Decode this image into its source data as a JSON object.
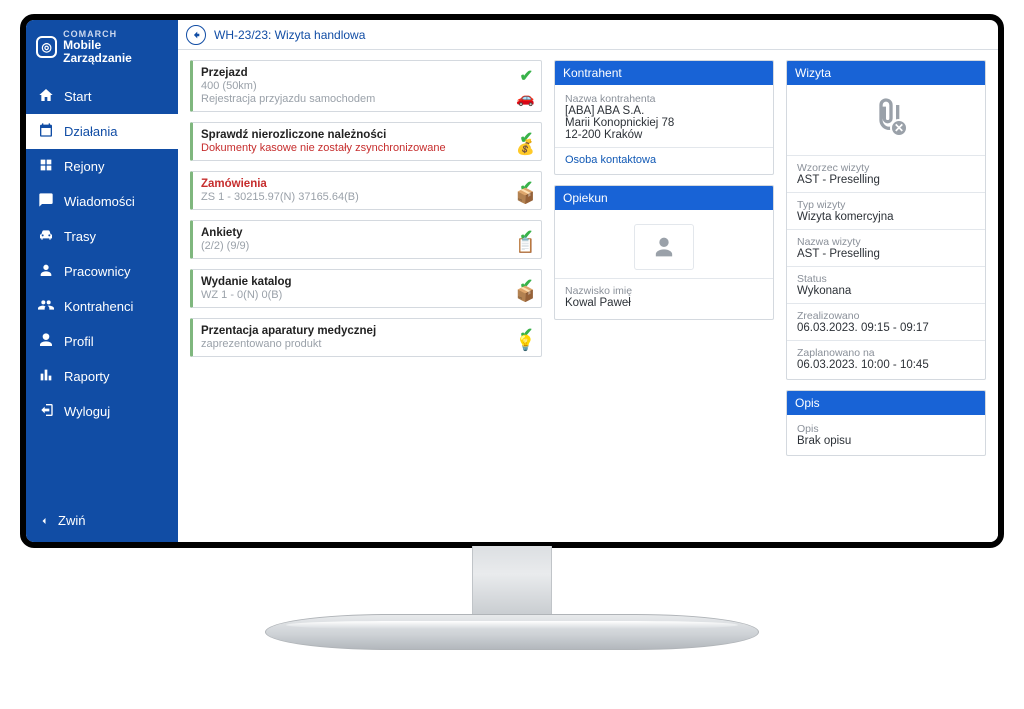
{
  "brand": {
    "top": "COMARCH",
    "bottom": "Mobile Zarządzanie"
  },
  "sidebar": {
    "items": [
      {
        "label": "Start",
        "icon": "home-icon"
      },
      {
        "label": "Działania",
        "icon": "calendar-icon",
        "active": true
      },
      {
        "label": "Rejony",
        "icon": "regions-icon"
      },
      {
        "label": "Wiadomości",
        "icon": "chat-icon"
      },
      {
        "label": "Trasy",
        "icon": "car-icon"
      },
      {
        "label": "Pracownicy",
        "icon": "users-icon"
      },
      {
        "label": "Kontrahenci",
        "icon": "contacts-icon"
      },
      {
        "label": "Profil",
        "icon": "profile-icon"
      },
      {
        "label": "Raporty",
        "icon": "chart-icon"
      },
      {
        "label": "Wyloguj",
        "icon": "logout-icon"
      }
    ],
    "collapse": "Zwiń"
  },
  "topbar": {
    "title": "WH-23/23: Wizyta handlowa"
  },
  "tasks": [
    {
      "title": "Przejazd",
      "line1": "400 (50km)",
      "line2": "Rejestracja przyjazdu samochodem",
      "icon": "🚗"
    },
    {
      "title": "Sprawdź nierozliczone należności",
      "line2": "Dokumenty kasowe nie zostały zsynchronizowane",
      "line2_red": true,
      "icon": "💰"
    },
    {
      "title": "Zamówienia",
      "title_red": true,
      "line1": "ZS 1 - 30215.97(N) 37165.64(B)",
      "icon": "📦"
    },
    {
      "title": "Ankiety",
      "line1": "(2/2) (9/9)",
      "icon": "📋"
    },
    {
      "title": "Wydanie katalog",
      "line1": "WZ 1 - 0(N) 0(B)",
      "icon": "📦"
    },
    {
      "title": "Przentacja aparatury medycznej",
      "line1": "zaprezentowano produkt",
      "icon": "💡"
    }
  ],
  "kontrahent": {
    "header": "Kontrahent",
    "name_label": "Nazwa kontrahenta",
    "name": "[ABA] ABA S.A.",
    "street": "Marii Konopnickiej 78",
    "city": "12-200 Kraków",
    "contact_link": "Osoba kontaktowa"
  },
  "opiekun": {
    "header": "Opiekun",
    "name_label": "Nazwisko imię",
    "name": "Kowal Paweł"
  },
  "wizyta": {
    "header": "Wizyta",
    "wzorzec_label": "Wzorzec wizyty",
    "wzorzec": "AST - Preselling",
    "typ_label": "Typ wizyty",
    "typ": "Wizyta komercyjna",
    "nazwa_label": "Nazwa wizyty",
    "nazwa": "AST - Preselling",
    "status_label": "Status",
    "status": "Wykonana",
    "zreal_label": "Zrealizowano",
    "zreal": "06.03.2023. 09:15 - 09:17",
    "zaplan_label": "Zaplanowano na",
    "zaplan": "06.03.2023. 10:00 - 10:45"
  },
  "opis": {
    "header": "Opis",
    "label": "Opis",
    "value": "Brak opisu"
  }
}
